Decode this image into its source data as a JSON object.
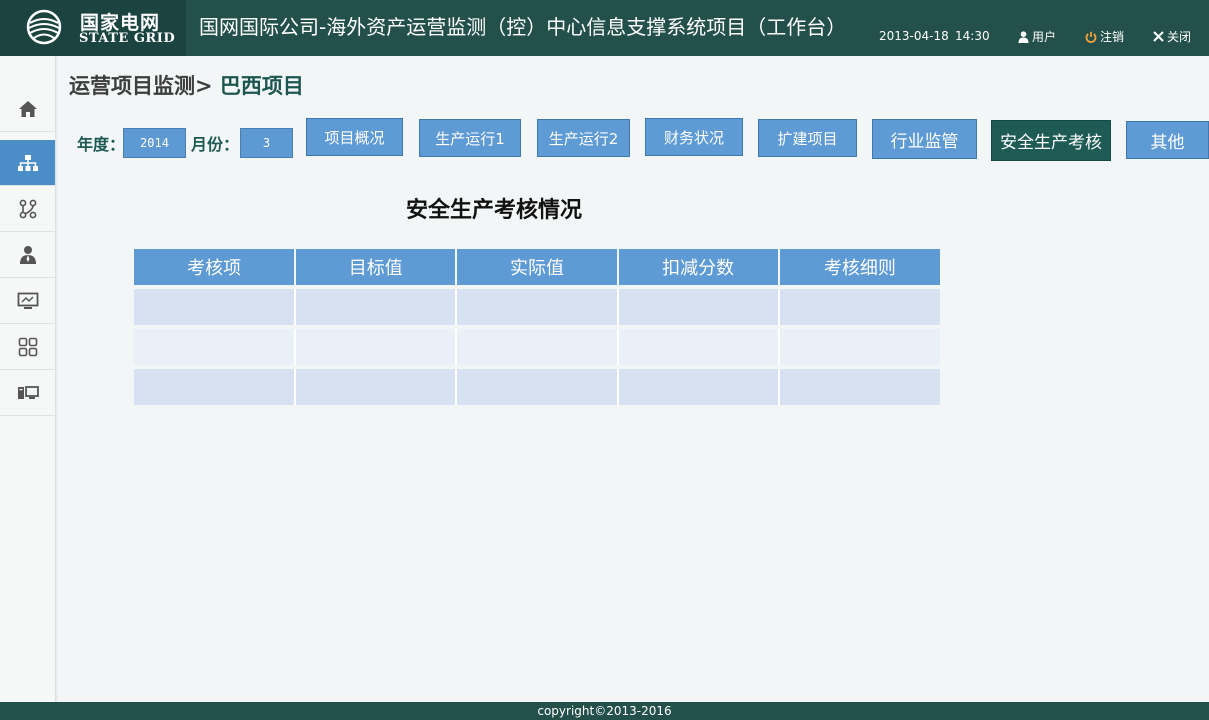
{
  "header": {
    "logo_cn": "国家电网",
    "logo_en": "STATE GRID",
    "title": "国网国际公司-海外资产运营监测（控）中心信息支撑系统项目（工作台）",
    "date": "2013-04-18",
    "time": "14:30",
    "user_label": "用户",
    "logout_label": "注销",
    "close_label": "关闭"
  },
  "sidebar": {
    "items": [
      {
        "icon": "home-icon",
        "active": false
      },
      {
        "icon": "org-chart-icon",
        "active": true
      },
      {
        "icon": "workflow-icon",
        "active": false
      },
      {
        "icon": "person-icon",
        "active": false
      },
      {
        "icon": "monitor-icon",
        "active": false
      },
      {
        "icon": "grid-icon",
        "active": false
      },
      {
        "icon": "computer-icon",
        "active": false
      }
    ]
  },
  "breadcrumb": {
    "parent": "运营项目监测>",
    "current": "巴西项目"
  },
  "filters": {
    "year_label": "年度：",
    "year_value": "2014",
    "month_label": "月份：",
    "month_value": "3"
  },
  "tabs": [
    {
      "label": "项目概况",
      "active": false
    },
    {
      "label": "生产运行1",
      "active": false
    },
    {
      "label": "生产运行2",
      "active": false
    },
    {
      "label": "财务状况",
      "active": false
    },
    {
      "label": "扩建项目",
      "active": false
    },
    {
      "label": "行业监管",
      "active": false
    },
    {
      "label": "安全生产考核",
      "active": true
    },
    {
      "label": "其他",
      "active": false
    }
  ],
  "section_title": "安全生产考核情况",
  "table": {
    "columns": [
      "考核项",
      "目标值",
      "实际值",
      "扣减分数",
      "考核细则"
    ],
    "rows": [
      [
        "",
        "",
        "",
        "",
        ""
      ],
      [
        "",
        "",
        "",
        "",
        ""
      ],
      [
        "",
        "",
        "",
        "",
        ""
      ]
    ]
  },
  "footer": {
    "copyright": "copyright©2013-2016"
  },
  "colors": {
    "header_bg": "#23504b",
    "tab_blue": "#5e9ad4",
    "tab_active": "#1e5b55",
    "sidebar_active": "#4b8ec7"
  }
}
